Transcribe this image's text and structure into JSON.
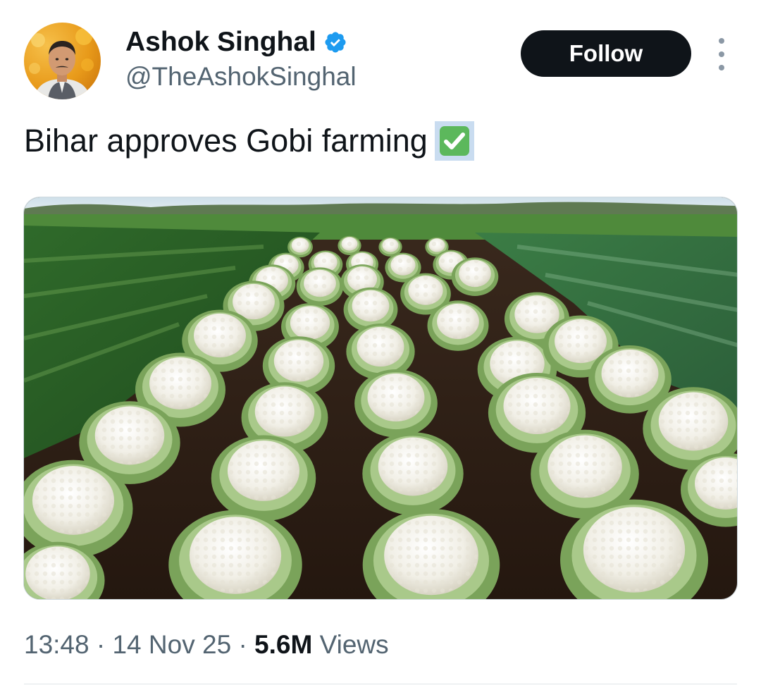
{
  "author": {
    "display_name": "Ashok Singhal",
    "handle": "@TheAshokSinghal",
    "verified_icon": "verified-badge-icon",
    "avatar_icon": "profile-photo"
  },
  "actions": {
    "follow_label": "Follow",
    "more_icon": "more-vertical-icon"
  },
  "tweet": {
    "text": "Bihar approves Gobi farming",
    "emoji": "check-mark-button-emoji",
    "media": "photo of cauliflower field"
  },
  "meta": {
    "time": "13:48",
    "sep1": "·",
    "date": "14 Nov 25",
    "sep2": "·",
    "views_count": "5.6M",
    "views_label": "Views"
  },
  "colors": {
    "follow_bg": "#0f1419",
    "verified_blue": "#1d9bf0",
    "muted_text": "#536471",
    "emoji_green": "#5cb85c"
  }
}
